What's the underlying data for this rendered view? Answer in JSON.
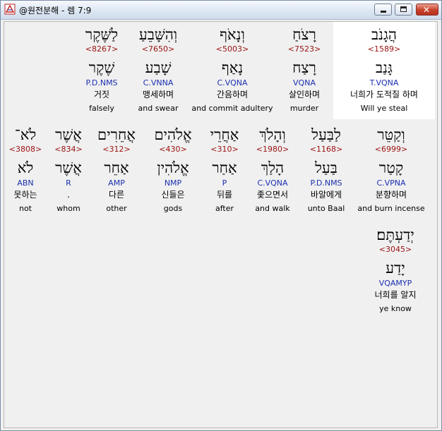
{
  "window": {
    "title": "@원전분해 - 렘 7:9",
    "buttons": {
      "minimize": "minimize",
      "maximize": "maximize",
      "close": "✕"
    }
  },
  "rows": [
    {
      "words": [
        {
          "heb": "לַשֶּׁקֶר",
          "num": "<8267>",
          "root": "שֶׁקֶר",
          "parse": "P.D.NMS",
          "kor": "거짓",
          "eng": "falsely"
        },
        {
          "heb": "וְהִשָּׁבֵעַ",
          "num": "<7650>",
          "root": "שָׁבַע",
          "parse": "C.VNNA",
          "kor": "맹세하며",
          "eng": "and swear"
        },
        {
          "heb": "וְנָאֹף",
          "num": "<5003>",
          "root": "נָאַף",
          "parse": "C.VQNA",
          "kor": "간음하며",
          "eng": "and commit adultery"
        },
        {
          "heb": "רָצֹחַ",
          "num": "<7523>",
          "root": "רָצַח",
          "parse": "VQNA",
          "kor": "살인하며",
          "eng": "murder"
        },
        {
          "heb": "הֲגָנֹב",
          "num": "<1589>",
          "root": "גָּנַב",
          "parse": "T.VQNA",
          "kor": "너희가 도적질 하며",
          "eng": "Will ye steal"
        }
      ]
    },
    {
      "words": [
        {
          "heb": "לֹא־",
          "num": "<3808>",
          "root": "לֹא",
          "parse": "ABN",
          "kor": "못하는",
          "eng": "not"
        },
        {
          "heb": "אֲשֶׁר",
          "num": "<834>",
          "root": "אֲשֶׁר",
          "parse": "R",
          "kor": ".",
          "eng": "whom"
        },
        {
          "heb": "אֲחֵרִים",
          "num": "<312>",
          "root": "אַחֵר",
          "parse": "AMP",
          "kor": "다른",
          "eng": "other"
        },
        {
          "heb": "אֱלֹהִים",
          "num": "<430>",
          "root": "אֱלֹהִין",
          "parse": "NMP",
          "kor": "신들은",
          "eng": "gods"
        },
        {
          "heb": "אַחֲרֵי",
          "num": "<310>",
          "root": "אַחַר",
          "parse": "P",
          "kor": "뒤를",
          "eng": "after"
        },
        {
          "heb": "וְהָלֹךְ",
          "num": "<1980>",
          "root": "הָלַךְ",
          "parse": "C.VQNA",
          "kor": "좇으면서",
          "eng": "and walk"
        },
        {
          "heb": "לַבַּעַל",
          "num": "<1168>",
          "root": "בַּעַל",
          "parse": "P.D.NMS",
          "kor": "바알에게",
          "eng": "unto Baal"
        },
        {
          "heb": "וְקַטֵּר",
          "num": "<6999>",
          "root": "קָטַר",
          "parse": "C.VPNA",
          "kor": "분향하며",
          "eng": "and burn incense"
        }
      ]
    },
    {
      "words": [
        {
          "heb": "יְדַעְתֶּם׃",
          "num": "<3045>",
          "root": "יָדַע",
          "parse": "VQAMYP",
          "kor": "너희를 알지",
          "eng": "ye know"
        }
      ]
    }
  ]
}
